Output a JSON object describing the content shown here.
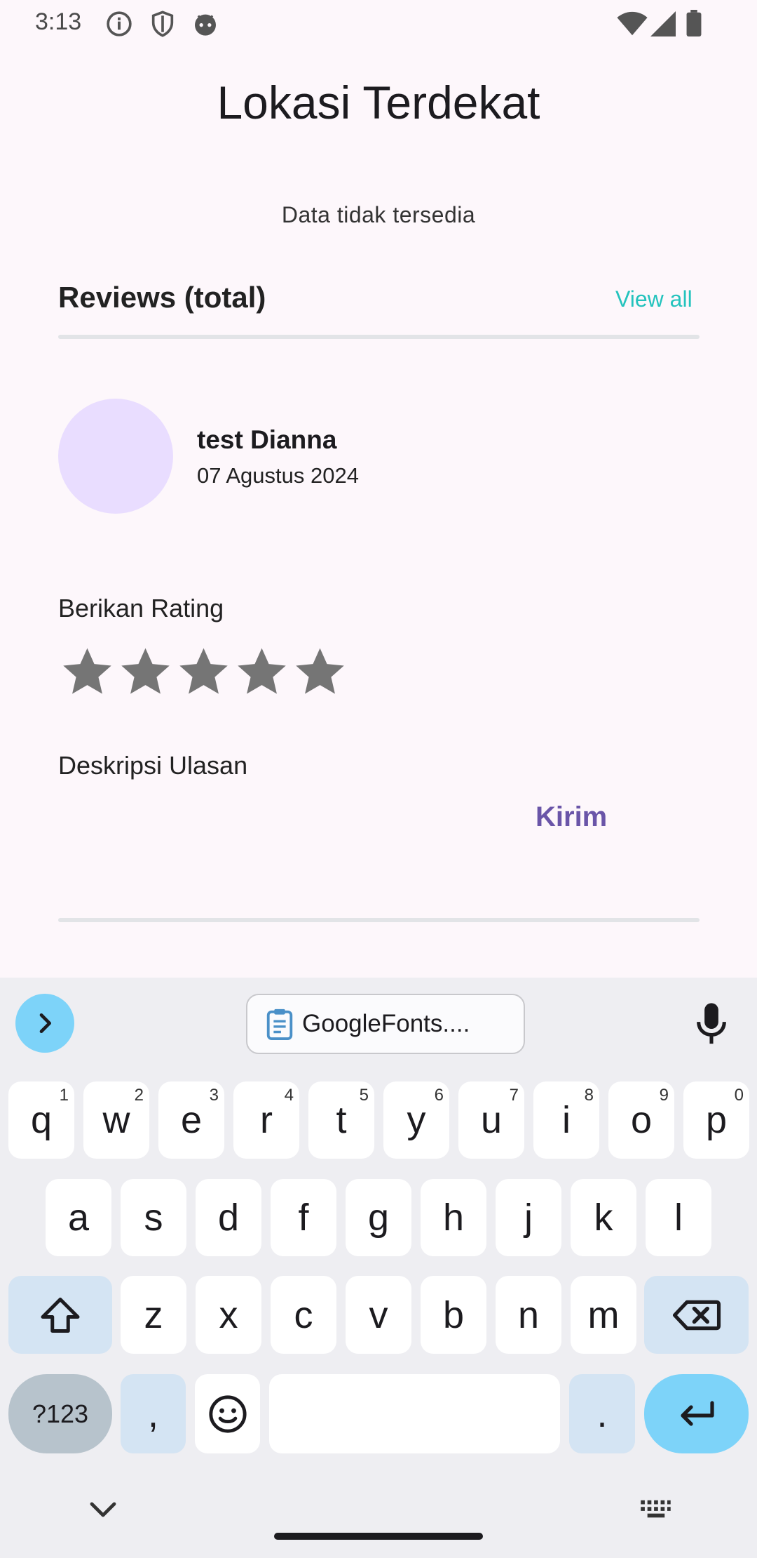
{
  "status_bar": {
    "time": "3:13",
    "left_icons": [
      "info-icon",
      "shield-icon",
      "android-icon"
    ],
    "right_icons": [
      "wifi-icon",
      "cellular-icon",
      "battery-icon"
    ]
  },
  "page": {
    "title": "Lokasi Terdekat",
    "empty_message": "Data tidak tersedia"
  },
  "reviews": {
    "title": "Reviews (total)",
    "view_all": "View all",
    "items": [
      {
        "name": "test Dianna",
        "date": "07 Agustus 2024",
        "avatar_color": "#e9ddff"
      }
    ]
  },
  "form": {
    "rating_label": "Berikan Rating",
    "rating_value": 0,
    "rating_max": 5,
    "description_label": "Deskripsi Ulasan",
    "description_value": "",
    "submit_label": "Kirim"
  },
  "keyboard": {
    "clipboard_chip": "GoogleFonts....",
    "row1": [
      {
        "k": "q",
        "h": "1"
      },
      {
        "k": "w",
        "h": "2"
      },
      {
        "k": "e",
        "h": "3"
      },
      {
        "k": "r",
        "h": "4"
      },
      {
        "k": "t",
        "h": "5"
      },
      {
        "k": "y",
        "h": "6"
      },
      {
        "k": "u",
        "h": "7"
      },
      {
        "k": "i",
        "h": "8"
      },
      {
        "k": "o",
        "h": "9"
      },
      {
        "k": "p",
        "h": "0"
      }
    ],
    "row2": [
      "a",
      "s",
      "d",
      "f",
      "g",
      "h",
      "j",
      "k",
      "l"
    ],
    "row3": [
      "z",
      "x",
      "c",
      "v",
      "b",
      "n",
      "m"
    ],
    "symbols_label": "?123",
    "comma_label": ",",
    "period_label": "."
  },
  "colors": {
    "background": "#fdf7fb",
    "accent_link": "#24c3bd",
    "submit": "#6a55a8",
    "star": "#757575",
    "keyboard_accent": "#7dd3f9"
  }
}
